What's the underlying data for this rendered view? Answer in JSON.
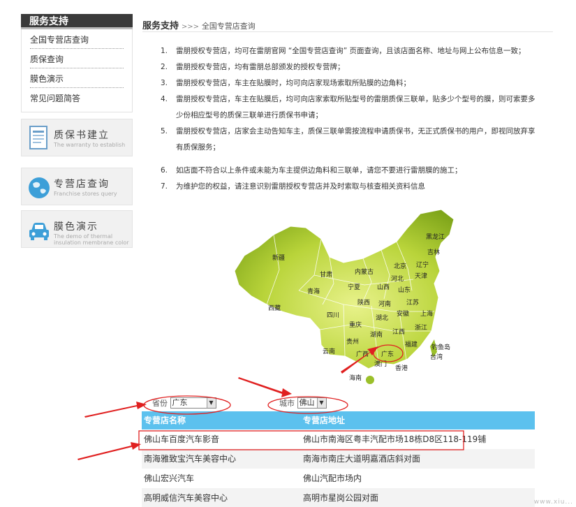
{
  "sidebar": {
    "title": "服务支持",
    "items": [
      {
        "label": "全国专营店查询"
      },
      {
        "label": "质保查询"
      },
      {
        "label": "膜色演示"
      },
      {
        "label": "常见问题简答"
      }
    ],
    "cards": [
      {
        "title": "质保书建立",
        "subtitle": "The warranty to establish",
        "icon": "document-icon"
      },
      {
        "title": "专营店查询",
        "subtitle": "Franchise stores query",
        "icon": "globe-icon"
      },
      {
        "title": "膜色演示",
        "subtitle": "The demo of thermal insulation membrane color",
        "icon": "car-icon"
      }
    ]
  },
  "breadcrumb": {
    "title": "服务支持",
    "separator": ">>>",
    "page": "全国专营店查询"
  },
  "notes": [
    {
      "num": "1.",
      "text": "雷朋授权专营店，均可在雷朋官网 “全国专营店查询” 页面查询，且该店面名称、地址与网上公布信息一致；"
    },
    {
      "num": "2.",
      "text": "雷朋授权专营店，均有雷朋总部颁发的授权专营牌；"
    },
    {
      "num": "3.",
      "text": "雷朋授权专营店，车主在贴膜时，均可向店家现场索取所贴膜的边角料；"
    },
    {
      "num": "4.",
      "text": "雷朋授权专营店，车主在贴膜后，均可向店家索取所贴型号的雷朋质保三联单，贴多少个型号的膜，则可索要多少份相应型号的质保三联单进行质保书申请；"
    },
    {
      "num": "5.",
      "text": "雷朋授权专营店，店家会主动告知车主，质保三联单需按流程申请质保书，无正式质保书的用户，即视同放弃享有质保服务；"
    },
    {
      "num": "6.",
      "text": "如店面不符合以上条件或未能为车主提供边角料和三联单，请您不要进行雷朋膜的施工；"
    },
    {
      "num": "7.",
      "text": "为维护您的权益，请注意识别雷朋授权专营店并及时索取与核查相关资料信息"
    }
  ],
  "map": {
    "provinces": [
      "黑龙江",
      "吉林",
      "辽宁",
      "北京",
      "天津",
      "内蒙古",
      "河北",
      "新疆",
      "甘肃",
      "宁夏",
      "山西",
      "山东",
      "青海",
      "陕西",
      "河南",
      "江苏",
      "西藏",
      "四川",
      "湖北",
      "安徽",
      "上海",
      "重庆",
      "浙江",
      "贵州",
      "湖南",
      "江西",
      "福建",
      "云南",
      "广西",
      "广东",
      "钓鱼岛",
      "台湾",
      "澳门",
      "香港",
      "海南"
    ],
    "highlight": "广东",
    "land_color": "#9bc02a"
  },
  "filters": {
    "province_label": "省份",
    "province_value": "广东",
    "city_label": "城市",
    "city_value": "佛山"
  },
  "table": {
    "headers": [
      "专营店名称",
      "专营店地址"
    ],
    "rows": [
      {
        "name": "佛山车百度汽车影音",
        "address": "佛山市南海区粤丰汽配市场18栋D8区118-119铺"
      },
      {
        "name": "南海雅致宝汽车美容中心",
        "address": "南海市南庄大道明嘉酒店斜对面"
      },
      {
        "name": "佛山宏兴汽车",
        "address": "佛山汽配市场内"
      },
      {
        "name": "高明威信汽车美容中心",
        "address": "高明市星岗公园对面"
      }
    ]
  },
  "watermark": "www.xiu...",
  "colors": {
    "accent": "#5cc1ee",
    "annotation": "#e02020",
    "sidebar_header": "#3a3a3a"
  }
}
